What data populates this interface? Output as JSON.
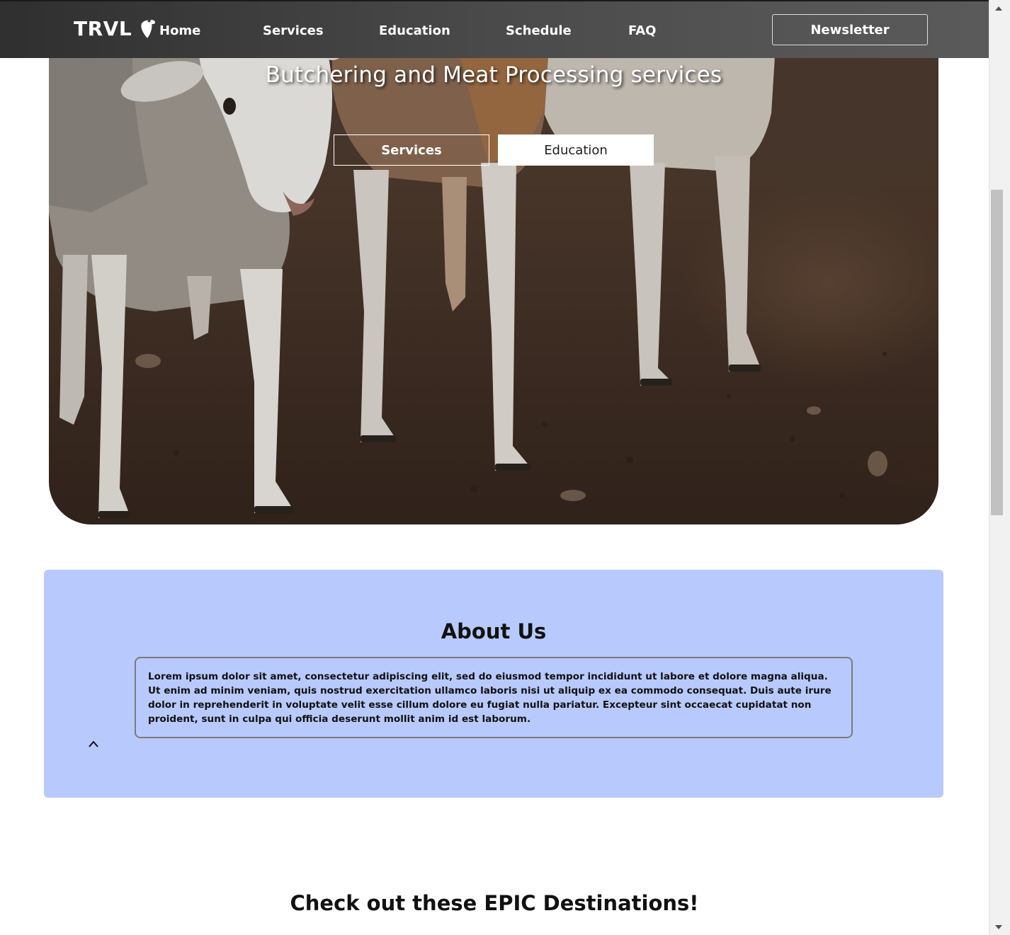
{
  "navbar": {
    "brand": "TRVL",
    "links": [
      "Home",
      "Services",
      "Education",
      "Schedule",
      "FAQ"
    ],
    "newsletter_label": "Newsletter"
  },
  "hero": {
    "title": "Butchering and Meat Processing services",
    "buttons": [
      "Services",
      "Education"
    ]
  },
  "about": {
    "title": "About Us",
    "body": "Lorem ipsum dolor sit amet, consectetur adipiscing elit, sed do eiusmod tempor incididunt ut labore et dolore magna aliqua. Ut enim ad minim veniam, quis nostrud exercitation ullamco laboris nisi ut aliquip ex ea commodo consequat. Duis aute irure dolor in reprehenderit in voluptate velit esse cillum dolore eu fugiat nulla pariatur. Excepteur sint occaecat cupidatat non proident, sunt in culpa qui officia deserunt mollit anim id est laborum.",
    "background_color": "#b8cafd"
  },
  "destinations": {
    "title": "Check out these EPIC Destinations!"
  },
  "icons": {
    "brand_logo": "typo3-logo-icon",
    "collapse": "chevron-up-icon"
  }
}
